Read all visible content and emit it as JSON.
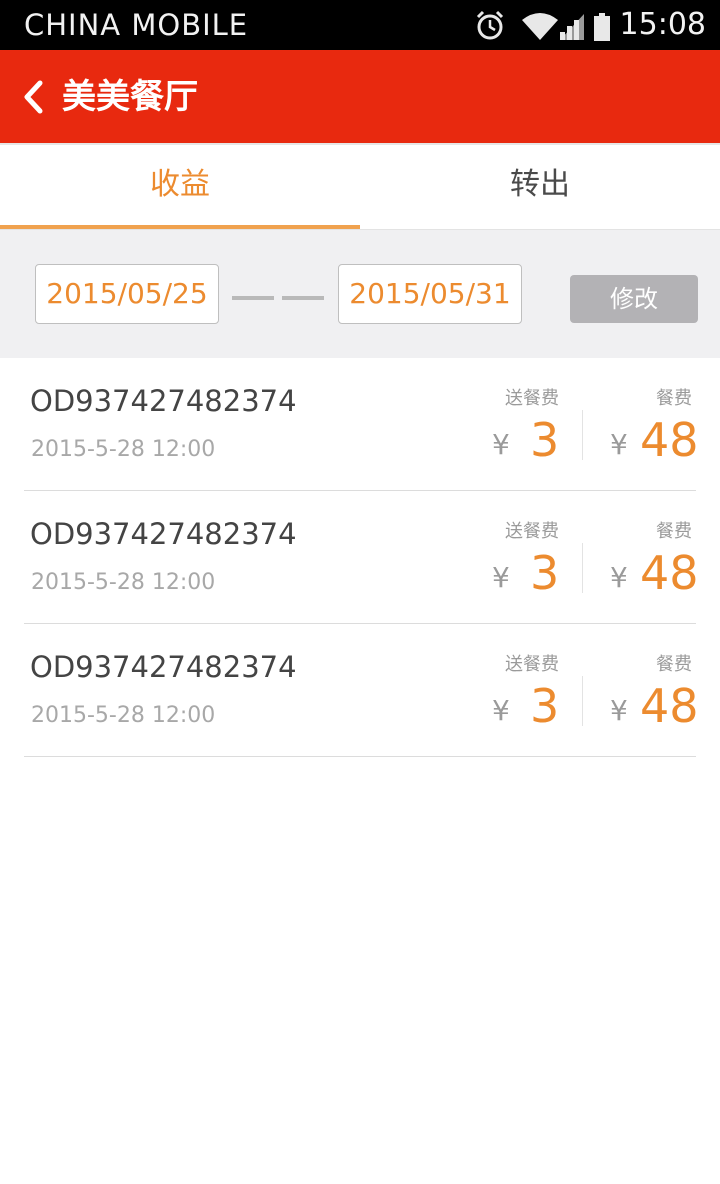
{
  "status_bar": {
    "carrier": "CHINA  MOBILE",
    "time": "15:08",
    "icons": [
      "alarm-icon",
      "wifi-icon",
      "signal-icon",
      "battery-icon"
    ]
  },
  "header": {
    "title": "美美餐厅",
    "back_icon": "chevron-left-icon",
    "background_color": "#e8290f"
  },
  "tabs": [
    {
      "label": "收益",
      "active": true
    },
    {
      "label": "转出",
      "active": false
    }
  ],
  "filter": {
    "start_date": "2015/05/25",
    "end_date": "2015/05/31",
    "modify_label": "修改"
  },
  "orders": [
    {
      "id": "OD937427482374",
      "time": "2015-5-28  12:00",
      "delivery_label": "送餐费",
      "food_label": "餐费",
      "currency": "¥",
      "delivery_fee": "3",
      "food_fee": "48"
    },
    {
      "id": "OD937427482374",
      "time": "2015-5-28  12:00",
      "delivery_label": "送餐费",
      "food_label": "餐费",
      "currency": "¥",
      "delivery_fee": "3",
      "food_fee": "48"
    },
    {
      "id": "OD937427482374",
      "time": "2015-5-28  12:00",
      "delivery_label": "送餐费",
      "food_label": "餐费",
      "currency": "¥",
      "delivery_fee": "3",
      "food_fee": "48"
    }
  ],
  "colors": {
    "accent": "#ec8b2f",
    "header": "#e8290f",
    "muted": "#a8a8a8"
  }
}
